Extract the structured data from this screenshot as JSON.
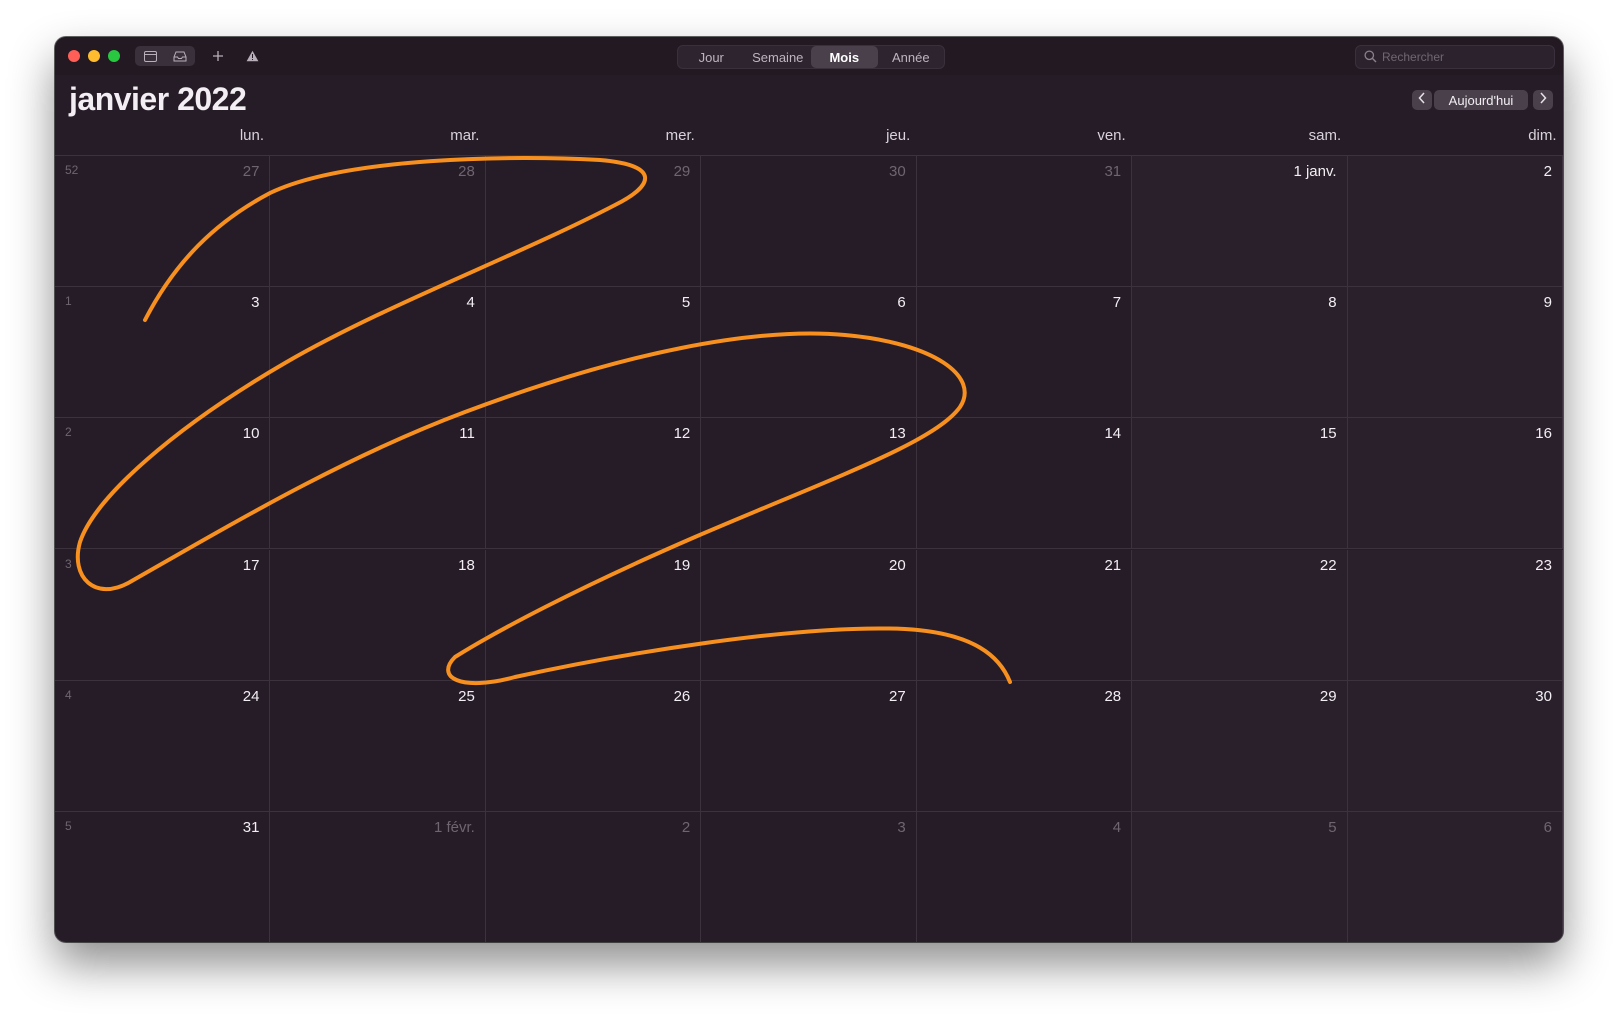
{
  "window": {
    "title": "janvier 2022",
    "traffic_lights": [
      "close-icon",
      "minimize-icon",
      "zoom-icon"
    ],
    "toolbar_icons": [
      "calendars-icon",
      "inbox-icon",
      "add-icon",
      "alert-icon"
    ],
    "view_tabs": [
      {
        "label": "Jour",
        "active": false
      },
      {
        "label": "Semaine",
        "active": false
      },
      {
        "label": "Mois",
        "active": true
      },
      {
        "label": "Année",
        "active": false
      }
    ],
    "search": {
      "placeholder": "Rechercher"
    },
    "today_button": "Aujourd'hui"
  },
  "weekdays": [
    "lun.",
    "mar.",
    "mer.",
    "jeu.",
    "ven.",
    "sam.",
    "dim."
  ],
  "weeks": [
    {
      "number": "52",
      "days": [
        {
          "label": "27",
          "in_month": false
        },
        {
          "label": "28",
          "in_month": false
        },
        {
          "label": "29",
          "in_month": false
        },
        {
          "label": "30",
          "in_month": false
        },
        {
          "label": "31",
          "in_month": false
        },
        {
          "label": "1 janv.",
          "in_month": true
        },
        {
          "label": "2",
          "in_month": true
        }
      ]
    },
    {
      "number": "1",
      "days": [
        {
          "label": "3",
          "in_month": true
        },
        {
          "label": "4",
          "in_month": true
        },
        {
          "label": "5",
          "in_month": true
        },
        {
          "label": "6",
          "in_month": true
        },
        {
          "label": "7",
          "in_month": true
        },
        {
          "label": "8",
          "in_month": true
        },
        {
          "label": "9",
          "in_month": true
        }
      ]
    },
    {
      "number": "2",
      "days": [
        {
          "label": "10",
          "in_month": true
        },
        {
          "label": "11",
          "in_month": true
        },
        {
          "label": "12",
          "in_month": true
        },
        {
          "label": "13",
          "in_month": true
        },
        {
          "label": "14",
          "in_month": true
        },
        {
          "label": "15",
          "in_month": true
        },
        {
          "label": "16",
          "in_month": true
        }
      ]
    },
    {
      "number": "3",
      "days": [
        {
          "label": "17",
          "in_month": true
        },
        {
          "label": "18",
          "in_month": true
        },
        {
          "label": "19",
          "in_month": true
        },
        {
          "label": "20",
          "in_month": true
        },
        {
          "label": "21",
          "in_month": true
        },
        {
          "label": "22",
          "in_month": true
        },
        {
          "label": "23",
          "in_month": true
        }
      ]
    },
    {
      "number": "4",
      "days": [
        {
          "label": "24",
          "in_month": true
        },
        {
          "label": "25",
          "in_month": true
        },
        {
          "label": "26",
          "in_month": true
        },
        {
          "label": "27",
          "in_month": true
        },
        {
          "label": "28",
          "in_month": true
        },
        {
          "label": "29",
          "in_month": true
        },
        {
          "label": "30",
          "in_month": true
        }
      ]
    },
    {
      "number": "5",
      "days": [
        {
          "label": "31",
          "in_month": true
        },
        {
          "label": "1 févr.",
          "in_month": false
        },
        {
          "label": "2",
          "in_month": false
        },
        {
          "label": "3",
          "in_month": false
        },
        {
          "label": "4",
          "in_month": false
        },
        {
          "label": "5",
          "in_month": false
        },
        {
          "label": "6",
          "in_month": false
        }
      ]
    }
  ],
  "colors": {
    "accent": "#f7901e",
    "background": "#261c28"
  }
}
